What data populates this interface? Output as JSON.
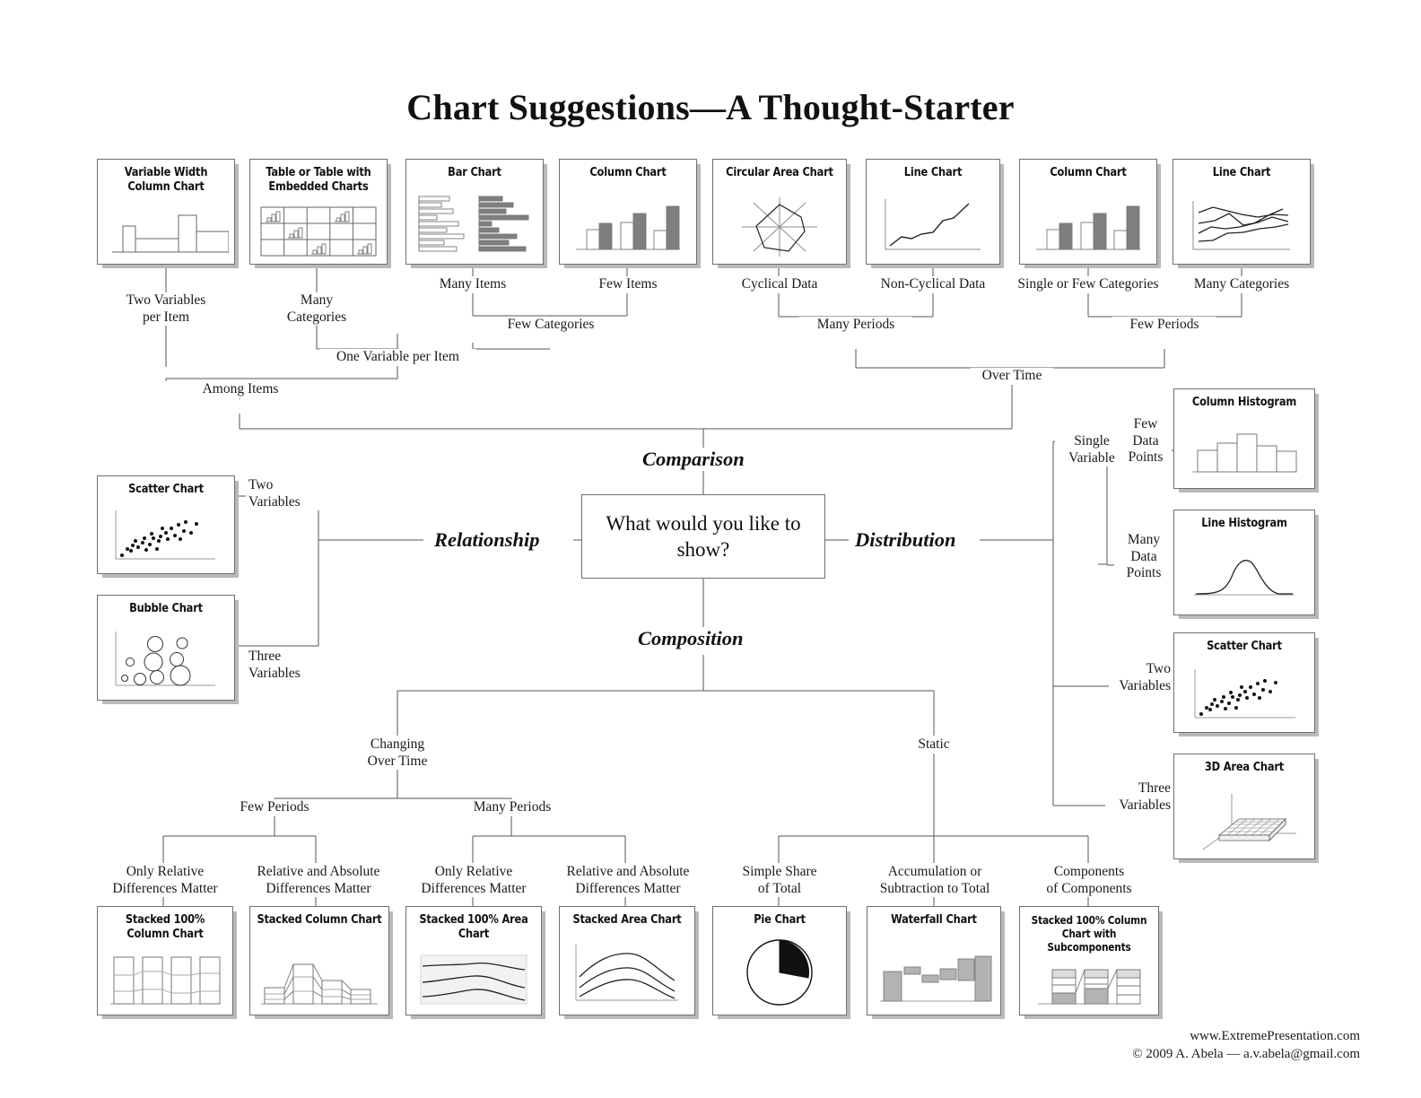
{
  "title": "Chart Suggestions—A Thought-Starter",
  "center": {
    "question": "What would you like to show?"
  },
  "branches": {
    "comparison": "Comparison",
    "relationship": "Relationship",
    "distribution": "Distribution",
    "composition": "Composition"
  },
  "cards": {
    "variable_width_column": "Variable Width\nColumn Chart",
    "table_embedded": "Table or Table with\nEmbedded Charts",
    "bar_chart": "Bar Chart",
    "column_chart_few": "Column Chart",
    "circular_area": "Circular Area Chart",
    "line_chart_noncyclical": "Line Chart",
    "column_chart_single": "Column Chart",
    "line_chart_many": "Line Chart",
    "scatter_rel": "Scatter Chart",
    "bubble_rel": "Bubble Chart",
    "column_histogram": "Column Histogram",
    "line_histogram": "Line Histogram",
    "scatter_dist": "Scatter Chart",
    "area_3d": "3D Area Chart",
    "stacked_100_column": "Stacked 100%\nColumn Chart",
    "stacked_column": "Stacked\nColumn Chart",
    "stacked_100_area": "Stacked 100%\nArea Chart",
    "stacked_area": "Stacked Area Chart",
    "pie_chart": "Pie Chart",
    "waterfall_chart": "Waterfall Chart",
    "stacked_100_subcomponents": "Stacked 100% Column Chart\nwith Subcomponents"
  },
  "labels": {
    "two_variables_per_item": "Two Variables\nper Item",
    "many_categories_top": "Many\nCategories",
    "many_items": "Many Items",
    "few_items": "Few Items",
    "few_categories": "Few Categories",
    "one_variable_per_item": "One Variable per Item",
    "among_items": "Among Items",
    "cyclical_data": "Cyclical Data",
    "non_cyclical_data": "Non-Cyclical Data",
    "single_or_few_categories": "Single or Few Categories",
    "many_categories_right": "Many Categories",
    "many_periods_top": "Many Periods",
    "few_periods_top": "Few Periods",
    "over_time": "Over Time",
    "two_variables_rel": "Two\nVariables",
    "three_variables_rel": "Three\nVariables",
    "single_variable": "Single\nVariable",
    "few_data_points": "Few\nData\nPoints",
    "many_data_points": "Many\nData\nPoints",
    "two_variables_dist": "Two\nVariables",
    "three_variables_dist": "Three\nVariables",
    "changing_over_time": "Changing\nOver Time",
    "static": "Static",
    "few_periods_comp": "Few Periods",
    "many_periods_comp": "Many Periods",
    "only_relative_1": "Only Relative\nDifferences Matter",
    "relative_absolute_1": "Relative and Absolute\nDifferences Matter",
    "only_relative_2": "Only Relative\nDifferences Matter",
    "relative_absolute_2": "Relative and Absolute\nDifferences Matter",
    "simple_share": "Simple Share\nof Total",
    "accumulation": "Accumulation or\nSubtraction to Total",
    "components_of_components": "Components\nof Components"
  },
  "footer": {
    "website": "www.ExtremePresentation.com",
    "copyright": "© 2009  A. Abela — a.v.abela@gmail.com"
  },
  "colors": {
    "ink": "#1a1a1a",
    "line": "#555555",
    "card_border": "#6f6f6f",
    "shadow": "#b9b9b9",
    "fill_gray": "#7f7f7f",
    "fill_light": "#ffffff"
  },
  "chart_data": {
    "type": "diagram",
    "title": "Chart Suggestions—A Thought-Starter",
    "root": "What would you like to show?",
    "branches": [
      {
        "name": "Comparison",
        "children": [
          {
            "name": "Among Items",
            "children": [
              {
                "name": "Two Variables per Item",
                "chart": "Variable Width Column Chart"
              },
              {
                "name": "One Variable per Item",
                "children": [
                  {
                    "name": "Many Categories",
                    "chart": "Table or Table with Embedded Charts"
                  },
                  {
                    "name": "Few Categories",
                    "children": [
                      {
                        "name": "Many Items",
                        "chart": "Bar Chart"
                      },
                      {
                        "name": "Few Items",
                        "chart": "Column Chart"
                      }
                    ]
                  }
                ]
              }
            ]
          },
          {
            "name": "Over Time",
            "children": [
              {
                "name": "Many Periods",
                "children": [
                  {
                    "name": "Cyclical Data",
                    "chart": "Circular Area Chart"
                  },
                  {
                    "name": "Non-Cyclical Data",
                    "chart": "Line Chart"
                  }
                ]
              },
              {
                "name": "Few Periods",
                "children": [
                  {
                    "name": "Single or Few Categories",
                    "chart": "Column Chart"
                  },
                  {
                    "name": "Many Categories",
                    "chart": "Line Chart"
                  }
                ]
              }
            ]
          }
        ]
      },
      {
        "name": "Relationship",
        "children": [
          {
            "name": "Two Variables",
            "chart": "Scatter Chart"
          },
          {
            "name": "Three Variables",
            "chart": "Bubble Chart"
          }
        ]
      },
      {
        "name": "Distribution",
        "children": [
          {
            "name": "Single Variable",
            "children": [
              {
                "name": "Few Data Points",
                "chart": "Column Histogram"
              },
              {
                "name": "Many Data Points",
                "chart": "Line Histogram"
              }
            ]
          },
          {
            "name": "Two Variables",
            "chart": "Scatter Chart"
          },
          {
            "name": "Three Variables",
            "chart": "3D Area Chart"
          }
        ]
      },
      {
        "name": "Composition",
        "children": [
          {
            "name": "Changing Over Time",
            "children": [
              {
                "name": "Few Periods",
                "children": [
                  {
                    "name": "Only Relative Differences Matter",
                    "chart": "Stacked 100% Column Chart"
                  },
                  {
                    "name": "Relative and Absolute Differences Matter",
                    "chart": "Stacked Column Chart"
                  }
                ]
              },
              {
                "name": "Many Periods",
                "children": [
                  {
                    "name": "Only Relative Differences Matter",
                    "chart": "Stacked 100% Area Chart"
                  },
                  {
                    "name": "Relative and Absolute Differences Matter",
                    "chart": "Stacked Area Chart"
                  }
                ]
              }
            ]
          },
          {
            "name": "Static",
            "children": [
              {
                "name": "Simple Share of Total",
                "chart": "Pie Chart"
              },
              {
                "name": "Accumulation or Subtraction to Total",
                "chart": "Waterfall Chart"
              },
              {
                "name": "Components of Components",
                "chart": "Stacked 100% Column Chart with Subcomponents"
              }
            ]
          }
        ]
      }
    ]
  }
}
